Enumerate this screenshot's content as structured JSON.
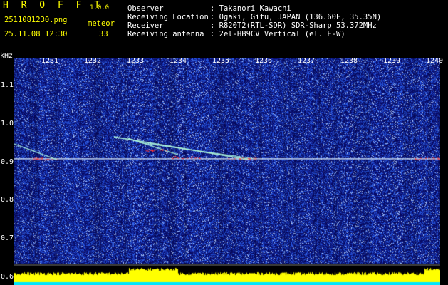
{
  "header": {
    "app_name": "H R O F F T",
    "version": "1.0.0",
    "filename": "2511081230.png",
    "timestamp": "25.11.08 12:30",
    "meteor_label": "meteor",
    "meteor_count": "33",
    "info": [
      {
        "key": "Observer",
        "value": ": Takanori Kawachi"
      },
      {
        "key": "Receiving Location",
        "value": ": Ogaki, Gifu, JAPAN (136.60E, 35.35N)"
      },
      {
        "key": "Receiver",
        "value": ": R820T2(RTL-SDR) SDR-Sharp 53.372MHz"
      },
      {
        "key": "Receiving antenna",
        "value": ": 2el-HB9CV Vertical (el. E-W)"
      }
    ]
  },
  "chart_data": {
    "type": "heatmap",
    "ylabel": "kHz",
    "x_ticks": [
      "1231",
      "1232",
      "1233",
      "1234",
      "1235",
      "1236",
      "1237",
      "1238",
      "1239",
      "1240"
    ],
    "y_ticks": [
      "1.1",
      "1.0",
      "0.9",
      "0.8",
      "0.7",
      "0.6"
    ],
    "ylim": [
      0.58,
      1.17
    ],
    "carrier_khz": 0.91,
    "colors": {
      "background": "#0a0a6e",
      "noise": "#3a6cff",
      "signal": "#ff3030",
      "level_bar": "#ffff00",
      "baseline": "#00e5ff"
    }
  }
}
